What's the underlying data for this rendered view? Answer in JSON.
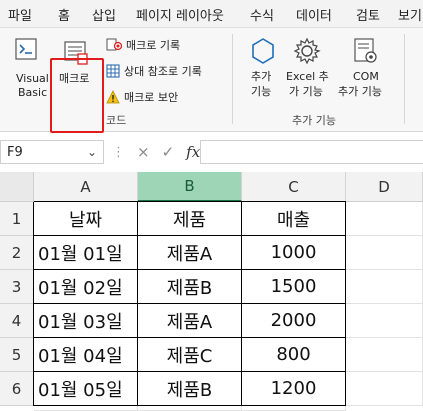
{
  "menu": [
    "파일",
    "홈",
    "삽입",
    "페이지 레이아웃",
    "수식",
    "데이터",
    "검토",
    "보기"
  ],
  "ribbon": {
    "code_group": {
      "visual_basic": [
        "Visual",
        "Basic"
      ],
      "macro": "매크로",
      "record_macro": "매크로 기록",
      "relative_ref": "상대 참조로 기록",
      "macro_security": "매크로 보안",
      "label": "코드"
    },
    "addins_group": {
      "addins": [
        "추가",
        "기능"
      ],
      "excel_addins": [
        "Excel 추",
        "가 기능"
      ],
      "com_addins": [
        "COM",
        "추가 기능"
      ],
      "label": "추가 기능"
    },
    "colors": {
      "accent_highlight": "#e21b1b",
      "addin_icon": "#1f6fb8"
    }
  },
  "formula_bar": {
    "name_box": "F9",
    "cancel_icon": "×",
    "enter_icon": "✓",
    "fx": "fx",
    "formula": ""
  },
  "sheet": {
    "columns": [
      "A",
      "B",
      "C",
      "D"
    ],
    "active_column": "B",
    "rows": [
      "1",
      "2",
      "3",
      "4",
      "5",
      "6"
    ],
    "header": [
      "날짜",
      "제품",
      "매출"
    ],
    "data": [
      [
        "01월 01일",
        "제품A",
        "1000"
      ],
      [
        "01월 02일",
        "제품B",
        "1500"
      ],
      [
        "01월 03일",
        "제품A",
        "2000"
      ],
      [
        "01월 04일",
        "제품C",
        "800"
      ],
      [
        "01월 05일",
        "제품B",
        "1200"
      ]
    ]
  }
}
